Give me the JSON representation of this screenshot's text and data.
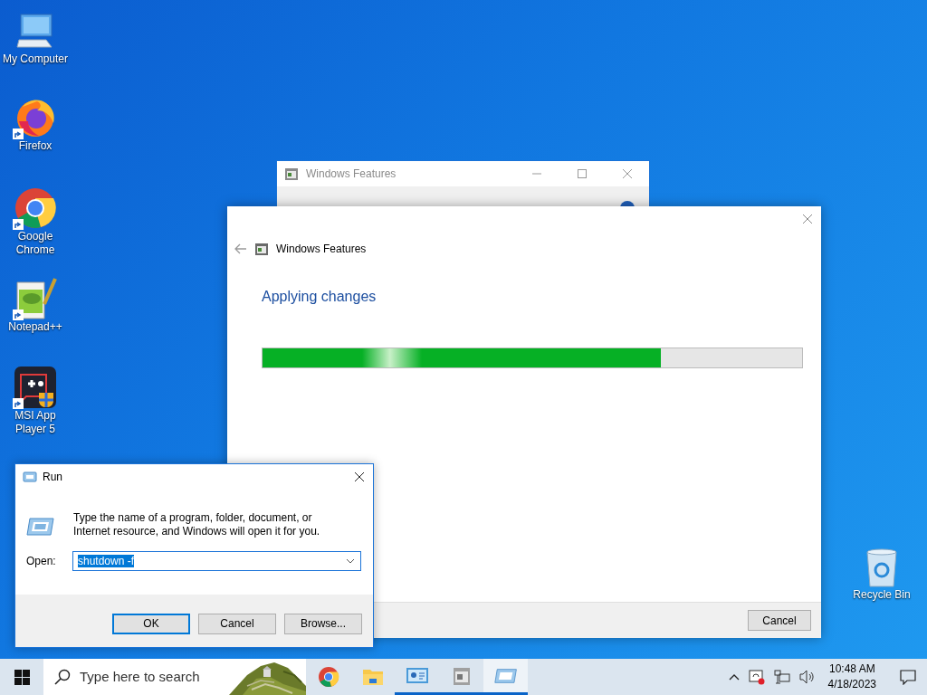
{
  "desktop_icons": [
    {
      "label": "My Computer",
      "shortcut": false
    },
    {
      "label": "Firefox",
      "shortcut": true
    },
    {
      "label": "Google Chrome",
      "shortcut": true
    },
    {
      "label": "Notepad++",
      "shortcut": true
    },
    {
      "label": "MSI App Player 5",
      "shortcut": true
    },
    {
      "label": "Recycle Bin",
      "shortcut": false
    }
  ],
  "back_window": {
    "title": "Windows Features"
  },
  "features_dialog": {
    "title": "Windows Features",
    "status": "Applying changes",
    "progress": {
      "level": 0.738
    },
    "buttons": [
      "Cancel"
    ]
  },
  "run_dialog": {
    "title": "Run",
    "description": "Type the name of a program, folder, document, or Internet resource, and Windows will open it for you.",
    "open_label": "Open:",
    "field": {
      "value": "shutdown -f",
      "selected": true
    },
    "buttons": [
      {
        "label": "OK",
        "default": true
      },
      {
        "label": "Cancel",
        "default": false
      },
      {
        "label": "Browse...",
        "default": false
      }
    ]
  },
  "taskbar": {
    "search": {
      "placeholder": "Type here to search"
    },
    "apps": [
      {
        "running": false,
        "selected": false
      },
      {
        "running": false,
        "selected": false
      },
      {
        "running": true,
        "selected": false
      },
      {
        "running": true,
        "selected": false
      },
      {
        "running": true,
        "selected": true
      }
    ],
    "clock": {
      "time": "10:48 AM",
      "date": "4/18/2023"
    }
  }
}
